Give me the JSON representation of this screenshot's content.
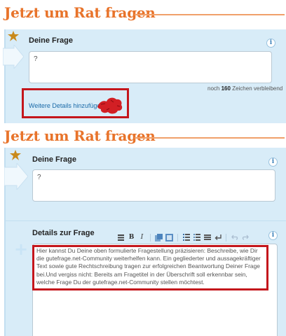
{
  "top": {
    "title": "Jetzt um Rat fragen",
    "question_label": "Deine Frage",
    "question_value": "?",
    "counter_prefix": "noch",
    "counter_value": "160",
    "counter_suffix": "Zeichen verbleibend",
    "details_link": "Weitere Details hinzufügen"
  },
  "bottom": {
    "title": "Jetzt um Rat fragen",
    "question_label": "Deine Frage",
    "question_value": "?",
    "details_label": "Details zur Frage",
    "details_placeholder": "Hier kannst Du Deine oben formulierte Fragestellung präzisieren: Beschreibe, wie Dir die gutefrage.net-Community weiterhelfen kann. Ein gegliederter und aussagekräftiger Text sowie gute Rechtschreibung tragen zur erfolgreichen Beantwortung Deiner Frage bei.Und vergiss nicht: Bereits am Fragetitel in der Überschrift soll erkennbar sein, welche Frage Du der gutefrage.net-Community stellen möchtest."
  },
  "toolbar": {
    "bold": "B",
    "italic": "I",
    "icons": [
      "paragraph-icon",
      "bold-icon",
      "italic-icon",
      "link-icon",
      "image-icon",
      "ordered-list-icon",
      "unordered-list-icon",
      "horizontal-rule-icon",
      "line-break-icon",
      "undo-icon",
      "redo-icon"
    ]
  },
  "info_glyph": "i",
  "colors": {
    "title": "#e8732a",
    "panel_bg": "#d8ecf8",
    "highlight": "#c4161c",
    "link": "#1a6aa8"
  }
}
